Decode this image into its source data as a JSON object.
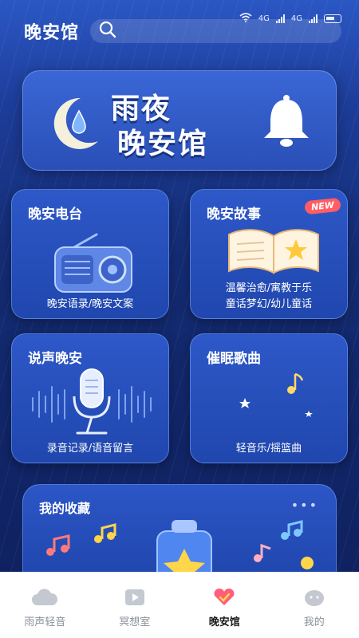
{
  "header": {
    "title": "晚安馆"
  },
  "status": {
    "signal1": "4G",
    "signal2": "4G"
  },
  "banner": {
    "line1": "雨夜",
    "line2": "晚安馆"
  },
  "cards": [
    {
      "title": "晚安电台",
      "subtitle": "晚安语录/晚安文案"
    },
    {
      "title": "晚安故事",
      "badge": "NEW",
      "subtitle_line1": "温馨治愈/寓教于乐",
      "subtitle_line2": "童话梦幻/幼儿童话"
    },
    {
      "title": "说声晚安",
      "subtitle": "录音记录/语音留言"
    },
    {
      "title": "催眠歌曲",
      "subtitle": "轻音乐/摇篮曲"
    }
  ],
  "favorites": {
    "title": "我的收藏",
    "more": "•••"
  },
  "tabs": [
    {
      "label": "雨声轻音",
      "icon": "cloud-icon"
    },
    {
      "label": "冥想室",
      "icon": "video-icon"
    },
    {
      "label": "晚安馆",
      "icon": "heart-icon",
      "active": true
    },
    {
      "label": "我的",
      "icon": "profile-icon"
    }
  ],
  "colors": {
    "accent": "#2a4fb7",
    "badge": "#ff5d63",
    "active_tab": "#ff5d7a"
  }
}
